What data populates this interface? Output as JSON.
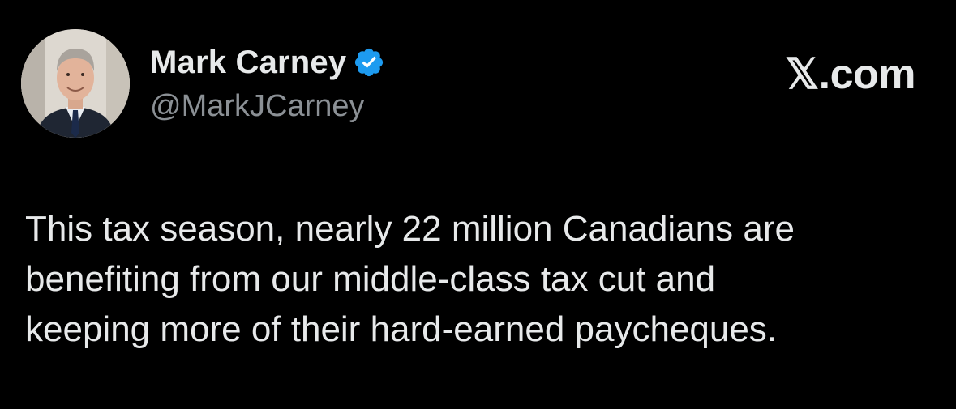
{
  "tweet": {
    "author": {
      "display_name": "Mark Carney",
      "handle": "@MarkJCarney",
      "verified": true,
      "avatar_icon": "profile-photo"
    },
    "brand": "𝕏.com",
    "text_lines": [
      "This tax season, nearly 22 million Canadians are",
      "benefiting from our middle-class tax cut and",
      "keeping more of their hard-earned paycheques."
    ]
  },
  "colors": {
    "background": "#000000",
    "primary_text": "#e7e9ea",
    "secondary_text": "#8b9095",
    "verified_badge": "#1d9bf0"
  }
}
